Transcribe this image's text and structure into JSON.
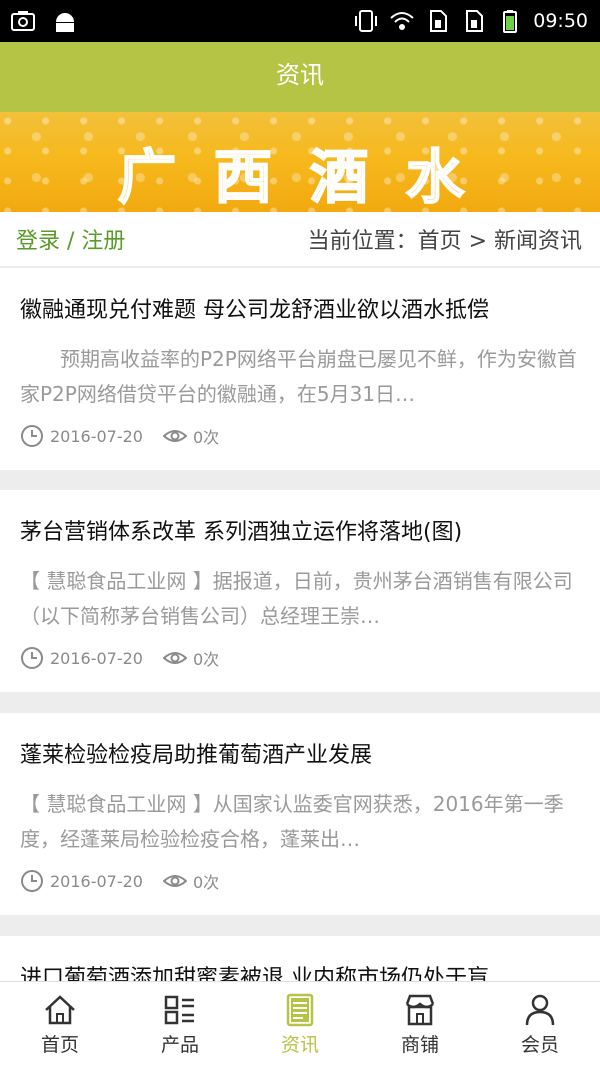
{
  "status_bar": {
    "time": "09:50",
    "left_icons": [
      "screenshot-icon",
      "android-icon"
    ],
    "right_icons": [
      "vibrate-icon",
      "wifi-icon",
      "sim1-icon",
      "sim2-icon",
      "battery-icon"
    ]
  },
  "header": {
    "title": "资讯",
    "color": "#b5c445"
  },
  "banner": {
    "text": "广西酒水"
  },
  "nav": {
    "login": "登录 / 注册",
    "breadcrumb": "当前位置：首页 > 新闻资讯"
  },
  "articles": [
    {
      "title": "徽融通现兑付难题 母公司龙舒酒业欲以酒水抵偿",
      "summary": "　　预期高收益率的P2P网络平台崩盘已屡见不鲜，作为安徽首家P2P网络借贷平台的徽融通，在5月31日…",
      "date": "2016-07-20",
      "views": "0次"
    },
    {
      "title": "茅台营销体系改革 系列酒独立运作将落地(图)",
      "summary": "【 慧聪食品工业网 】据报道，日前，贵州茅台酒销售有限公司（以下简称茅台销售公司）总经理王崇…",
      "date": "2016-07-20",
      "views": "0次"
    },
    {
      "title": "蓬莱检验检疫局助推葡萄酒产业发展",
      "summary": "【 慧聪食品工业网 】从国家认监委官网获悉，2016年第一季度，经蓬莱局检验检疫合格，蓬莱出…",
      "date": "2016-07-20",
      "views": "0次"
    },
    {
      "title": "进口葡萄酒添加甜蜜素被退 业内称市场仍处于盲…",
      "summary": "",
      "date": "",
      "views": ""
    }
  ],
  "tabbar": {
    "active_color": "#b5c445",
    "tabs": [
      {
        "label": "首页",
        "icon": "home-icon"
      },
      {
        "label": "产品",
        "icon": "list-icon"
      },
      {
        "label": "资讯",
        "icon": "document-icon"
      },
      {
        "label": "商铺",
        "icon": "store-icon"
      },
      {
        "label": "会员",
        "icon": "user-icon"
      }
    ]
  }
}
